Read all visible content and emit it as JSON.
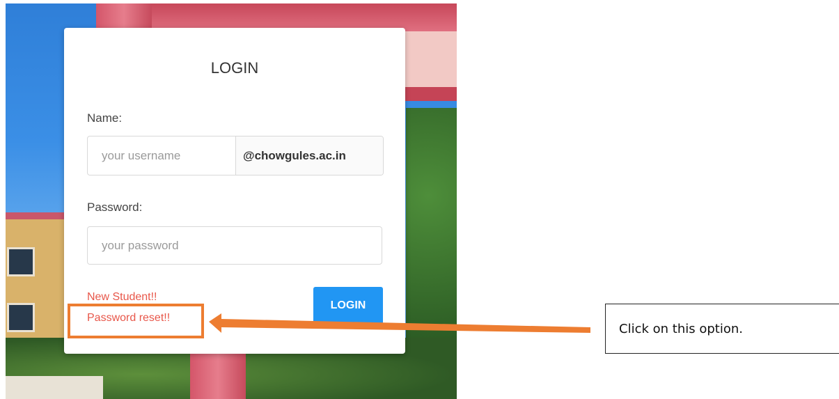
{
  "login_card": {
    "title": "LOGIN",
    "name_label": "Name:",
    "username_placeholder": "your username",
    "domain_suffix": "@chowgules.ac.in",
    "password_label": "Password:",
    "password_placeholder": "your password",
    "new_student_link": "New Student!!",
    "password_reset_link": "Password reset!!",
    "login_button": "LOGIN"
  },
  "annotation": {
    "callout_text": "Click on this option.",
    "highlight_color": "#ed7d31"
  },
  "colors": {
    "link": "#e8574a",
    "button": "#2196f3"
  },
  "icons": [
    "arrow-left-icon"
  ]
}
